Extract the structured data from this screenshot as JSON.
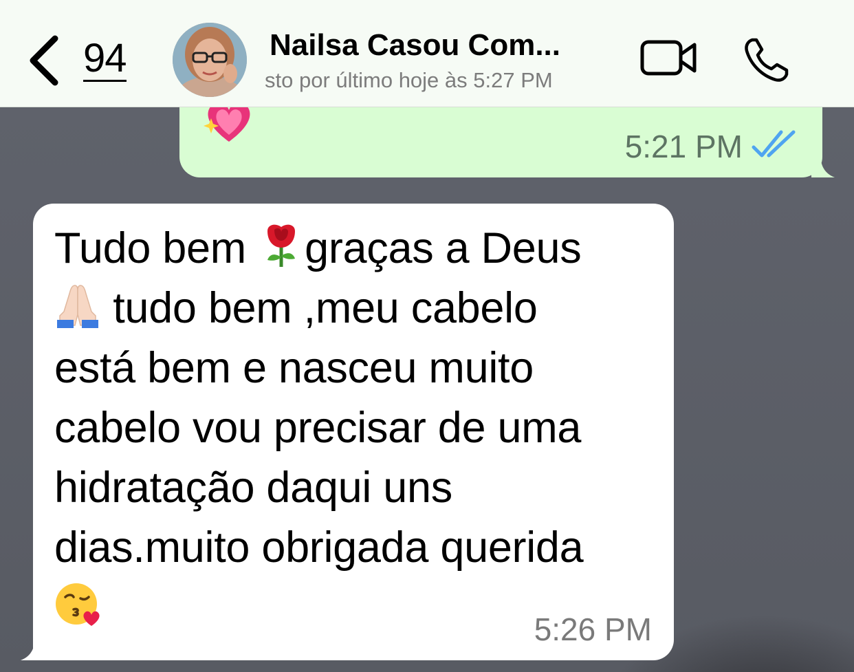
{
  "header": {
    "back_count": "94",
    "contact_name": "Nailsa Casou Com...",
    "status": "sto por último hoje às 5:27 PM"
  },
  "messages": [
    {
      "direction": "outgoing",
      "emoji": "sparkling-heart",
      "time": "5:21 PM",
      "read_receipt": "double-check-blue"
    },
    {
      "direction": "incoming",
      "lines": [
        "Tudo bem ",
        "graças a Deus",
        " tudo bem ,meu cabelo",
        "está bem e nasceu muito",
        "cabelo vou precisar de uma",
        "hidratação daqui uns",
        "dias.muito obrigada querida"
      ],
      "emojis": [
        "rose",
        "folded-hands",
        "kissing-face-heart"
      ],
      "time": "5:26 PM"
    }
  ],
  "colors": {
    "header_bg": "#f6fbf5",
    "outgoing_bubble": "#d9fdd3",
    "incoming_bubble": "#ffffff",
    "read_ticks": "#4fa4f0"
  }
}
